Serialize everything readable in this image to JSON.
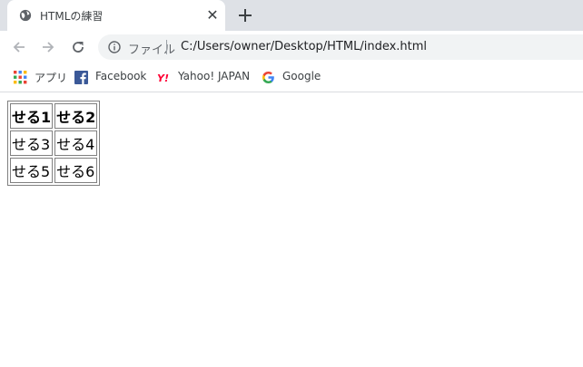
{
  "tab": {
    "title": "HTMLの練習",
    "close_glyph": "✕",
    "favicon": "globe-icon"
  },
  "toolbar": {
    "back_icon": "arrow-left-icon",
    "forward_icon": "arrow-right-icon",
    "reload_icon": "reload-icon",
    "info_icon": "info-icon",
    "scheme_label": "ファイル",
    "url": "C:/Users/owner/Desktop/HTML/index.html"
  },
  "bookmarks": [
    {
      "label": "アプリ",
      "icon": "apps-grid-icon"
    },
    {
      "label": "Facebook",
      "icon": "facebook-icon"
    },
    {
      "label": "Yahoo! JAPAN",
      "icon": "yahoo-icon"
    },
    {
      "label": "Google",
      "icon": "google-icon"
    }
  ],
  "table": {
    "headers": [
      "せる1",
      "せる2"
    ],
    "rows": [
      [
        "せる3",
        "せる4"
      ],
      [
        "せる5",
        "せる6"
      ]
    ]
  },
  "colors": {
    "tabstrip": "#dee1e6",
    "omnibox": "#f1f3f4",
    "facebook": "#3b5998",
    "yahoo": "#ff0033"
  }
}
